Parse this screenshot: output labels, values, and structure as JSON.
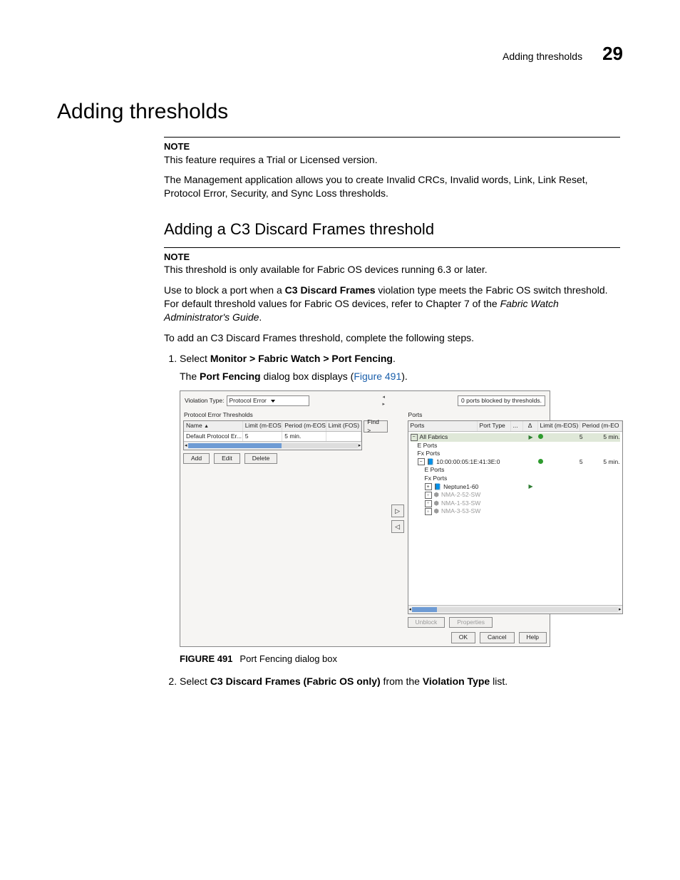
{
  "header": {
    "running_title": "Adding thresholds",
    "page_number": "29"
  },
  "h1": "Adding thresholds",
  "note1": {
    "label": "NOTE",
    "text": "This feature requires a Trial or Licensed version."
  },
  "intro": "The Management application allows you to create Invalid CRCs, Invalid words, Link, Link Reset, Protocol Error, Security, and Sync Loss thresholds.",
  "h2": "Adding a C3 Discard Frames threshold",
  "note2": {
    "label": "NOTE",
    "text": "This threshold is only available for Fabric OS devices running 6.3 or later."
  },
  "para2a_pre": "Use to block a port when a ",
  "para2a_bold": "C3 Discard Frames",
  "para2a_mid": " violation type meets the Fabric OS switch threshold. For default threshold values for Fabric OS devices, refer to Chapter 7 of the ",
  "para2a_italic": "Fabric Watch Administrator's Guide",
  "para2a_end": ".",
  "para2b": "To add an C3 Discard Frames threshold, complete the following steps.",
  "step1": {
    "pre": "Select ",
    "bold": "Monitor > Fabric Watch > Port Fencing",
    "post": ".",
    "body_pre": "The ",
    "body_bold": "Port Fencing",
    "body_mid": " dialog box displays (",
    "body_xref": "Figure 491",
    "body_end": ")."
  },
  "step2": {
    "pre": "Select ",
    "bold1": "C3 Discard Frames (Fabric OS only)",
    "mid": " from the ",
    "bold2": "Violation Type",
    "post": " list."
  },
  "figure": {
    "label": "FIGURE 491",
    "caption": "Port Fencing dialog box"
  },
  "dlg": {
    "violation_label": "Violation Type:",
    "violation_value": "Protocol Error",
    "blocked_msg": "0 ports blocked by thresholds.",
    "left_title": "Protocol Error Thresholds",
    "left_cols": {
      "name": "Name",
      "lmeos": "Limit (m-EOS)",
      "pmeos": "Period (m-EOS)",
      "lfos": "Limit (FOS)"
    },
    "left_row": {
      "name": "Default Protocol Er...",
      "lmeos": "5",
      "pmeos": "5 min.",
      "lfos": ""
    },
    "find": "Find >",
    "btn_add": "Add",
    "btn_edit": "Edit",
    "btn_delete": "Delete",
    "right_title": "Ports",
    "right_cols": {
      "ports": "Ports",
      "ptype": "Port Type",
      "dots": "...",
      "delta": "Δ",
      "lmeos": "Limit (m-EOS)",
      "pmeos": "Period (m-EO"
    },
    "tree": {
      "all": "All Fabrics",
      "eports": "E Ports",
      "fxports": "Fx Ports",
      "wwn": "10:00:00:05:1E:41:3E:0",
      "nodes": [
        "Neptune1-60",
        "NMA-2-52-SW",
        "NMA-1-53-SW",
        "NMA-3-53-SW"
      ]
    },
    "right_rows": [
      {
        "delta_dot": true,
        "lmeos": "5",
        "pmeos": "5 min."
      },
      {
        "delta_dot": true,
        "lmeos": "5",
        "pmeos": "5 min."
      }
    ],
    "btn_unblock": "Unblock",
    "btn_props": "Properties",
    "btn_ok": "OK",
    "btn_cancel": "Cancel",
    "btn_help": "Help"
  }
}
